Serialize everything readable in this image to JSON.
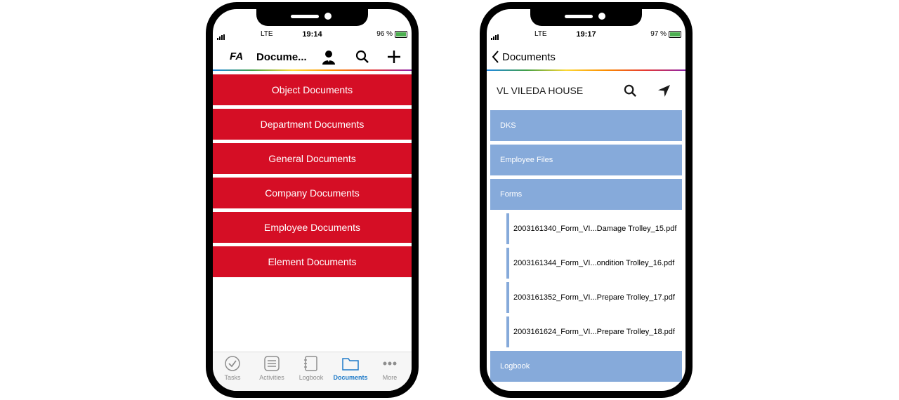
{
  "phone1": {
    "status": {
      "network": "LTE",
      "time": "19:14",
      "battery": "96 %"
    },
    "nav": {
      "logo": "FA",
      "title": "Docume...",
      "icons": [
        "person-icon",
        "search-icon",
        "plus-icon"
      ]
    },
    "menu": [
      "Object Documents",
      "Department Documents",
      "General Documents",
      "Company Documents",
      "Employee Documents",
      "Element Documents"
    ],
    "tabs": [
      {
        "label": "Tasks",
        "icon": "check-circle-icon",
        "active": false
      },
      {
        "label": "Activities",
        "icon": "list-icon",
        "active": false
      },
      {
        "label": "Logbook",
        "icon": "notebook-icon",
        "active": false
      },
      {
        "label": "Documents",
        "icon": "folder-icon",
        "active": true
      },
      {
        "label": "More",
        "icon": "more-icon",
        "active": false
      }
    ],
    "accent": "#d50e25",
    "active_tab_color": "#1e7ac8"
  },
  "phone2": {
    "status": {
      "network": "LTE",
      "time": "19:17",
      "battery": "97 %"
    },
    "nav": {
      "back_label": "Documents"
    },
    "location": "VL VILEDA HOUSE",
    "folders_top": [
      "DKS",
      "Employee Files",
      "Forms"
    ],
    "files": [
      "2003161340_Form_VI...Damage Trolley_15.pdf",
      "2003161344_Form_VI...ondition Trolley_16.pdf",
      "2003161352_Form_VI...Prepare Trolley_17.pdf",
      "2003161624_Form_VI...Prepare Trolley_18.pdf"
    ],
    "folders_bottom": [
      "Logbook"
    ],
    "accent": "#86aada"
  }
}
